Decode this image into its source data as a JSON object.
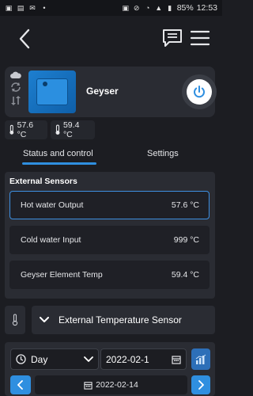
{
  "status_bar": {
    "battery": "85%",
    "time": "12:53",
    "left_icons": [
      "sim-card-icon",
      "image-icon",
      "mail-icon",
      "dot-icon"
    ],
    "right_icons": [
      "sim-card-icon",
      "mute-icon",
      "wifi-icon",
      "signal-icon",
      "battery-icon"
    ]
  },
  "app_bar": {
    "icons": [
      "back-arrow-icon",
      "chat-icon",
      "hamburger-menu-icon"
    ]
  },
  "device": {
    "name": "Geyser",
    "side_icons": [
      "cloud-icon",
      "sync-icon",
      "sort-icon"
    ],
    "power_icon": "power-icon",
    "temperatures": [
      {
        "value": "57.6 °C",
        "icon": "thermometer-icon"
      },
      {
        "value": "59.4 °C",
        "icon": "thermometer-icon"
      }
    ]
  },
  "tabs": [
    {
      "label": "Status and control",
      "active": true
    },
    {
      "label": "Settings",
      "active": false
    }
  ],
  "external_sensors": {
    "title": "External Sensors",
    "rows": [
      {
        "label": "Hot water Output",
        "value": "57.6 °C",
        "active": true
      },
      {
        "label": "Cold water Input",
        "value": "999 °C",
        "active": false
      },
      {
        "label": "Geyser Element Temp",
        "value": "59.4 °C",
        "active": false
      }
    ]
  },
  "external_selector": {
    "label": "External Temperature Sensor",
    "icon": "thermometer-icon"
  },
  "history": {
    "period": "Day",
    "date_value": "2022-02-1",
    "date_label": "2022-02-14",
    "icons": [
      "clock-icon",
      "chevron-down-icon",
      "calendar-icon",
      "bar-chart-icon",
      "chevron-left-icon",
      "chevron-right-icon"
    ]
  },
  "colors": {
    "background": "#1c1d22",
    "card": "#2a2c33",
    "accent": "#2f8fe0",
    "text": "#e6e7ea"
  }
}
